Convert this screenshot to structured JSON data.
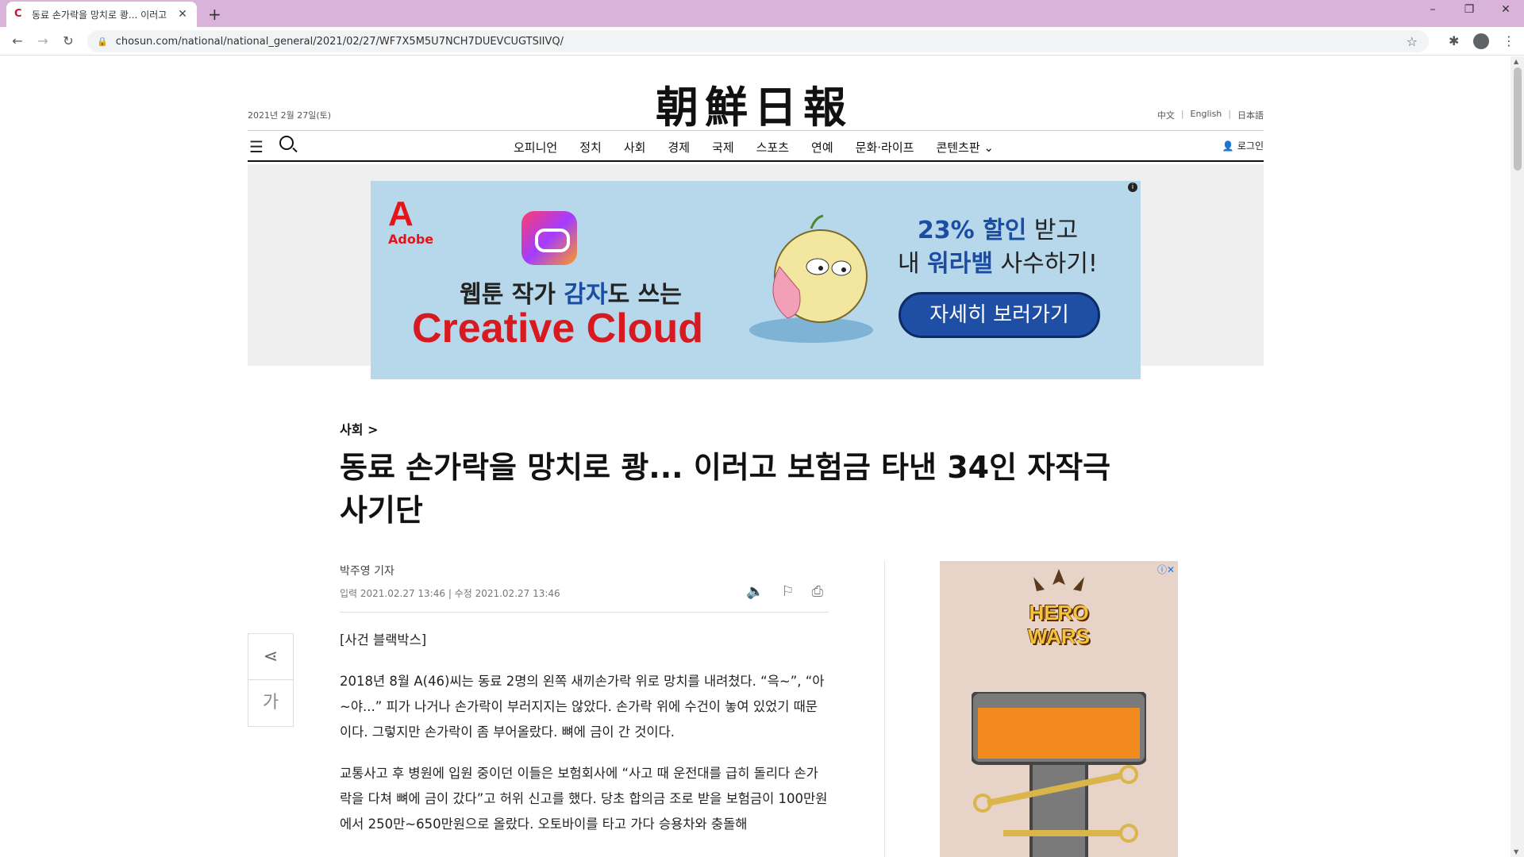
{
  "browser": {
    "tab_title": "동료 손가락을 망치로 쾅... 이러고",
    "tab_close": "✕",
    "new_tab": "+",
    "url": "chosun.com/national/national_general/2021/02/27/WF7X5M5U7NCH7DUEVCUGTSIIVQ/",
    "window_controls": [
      "–",
      "❐",
      "✕"
    ]
  },
  "header": {
    "logo": "朝鮮日報",
    "date": "2021년 2월 27일(토)",
    "languages": [
      "中文",
      "English",
      "日本語"
    ],
    "lang_sep": "|",
    "nav": [
      "오피니언",
      "정치",
      "사회",
      "경제",
      "국제",
      "스포츠",
      "연예",
      "문화·라이프",
      "콘텐츠판"
    ],
    "active_nav": "사회",
    "login": "로그인"
  },
  "top_ad": {
    "brand": "Adobe",
    "line1_pre": "웹툰 작가 ",
    "line1_hl": "감자",
    "line1_post": "도 쓰는",
    "line2": "Creative Cloud",
    "promo1_hl": "23% 할인",
    "promo1_post": " 받고",
    "promo2_pre": "내 ",
    "promo2_hl": "워라밸",
    "promo2_post": " 사수하기!",
    "cta": "자세히 보러가기"
  },
  "article": {
    "section": "사회 >",
    "headline": "동료 손가락을 망치로 쾅... 이러고 보험금 타낸 34인 자작극 사기단",
    "byline": "박주영 기자",
    "dateline": "입력 2021.02.27 13:46 | 수정 2021.02.27 13:46",
    "paragraphs": [
      "[사건 블랙박스]",
      "2018년 8월 A(46)씨는 동료 2명의 왼쪽 새끼손가락 위로 망치를 내려쳤다. “윽~”, “아~야...” 피가 나거나 손가락이 부러지지는 않았다. 손가락 위에 수건이 놓여 있었기 때문이다. 그렇지만 손가락이 좀 부어올랐다. 뼈에 금이 간 것이다.",
      "교통사고 후 병원에 입원 중이던 이들은 보험회사에 “사고 때 운전대를 급히 돌리다 손가락을 다쳐 뼈에 금이 갔다”고 허위 신고를 했다. 당초 합의금 조로 받을 보험금이 100만원에서 250만~650만원으로 올랐다. 오토바이를 타고 가다 승용차와 충돌해"
    ]
  },
  "share": {
    "font_label": "가"
  },
  "side_ad": {
    "title": "HERO WARS"
  }
}
